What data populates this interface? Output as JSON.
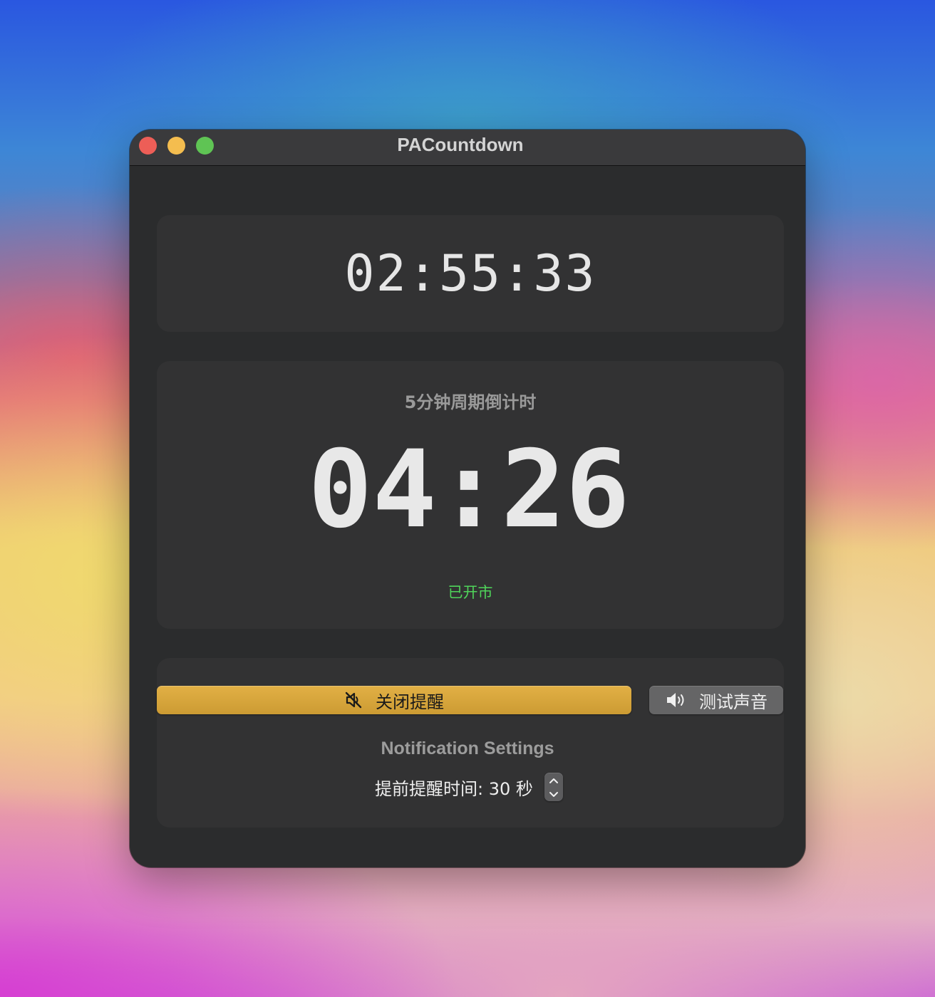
{
  "window": {
    "title": "PACountdown"
  },
  "clock": {
    "time": "02:55:33"
  },
  "cycle": {
    "label": "5分钟周期倒计时",
    "time": "04:26",
    "status": "已开市",
    "status_color": "#4fd45a"
  },
  "controls": {
    "alert_button": {
      "label": "关闭提醒",
      "icon": "speaker-muted-icon",
      "color": "#d4a33b"
    },
    "test_button": {
      "label": "测试声音",
      "icon": "speaker-wave-icon"
    },
    "settings_title": "Notification Settings",
    "lead_time_text": "提前提醒时间: 30 秒"
  }
}
